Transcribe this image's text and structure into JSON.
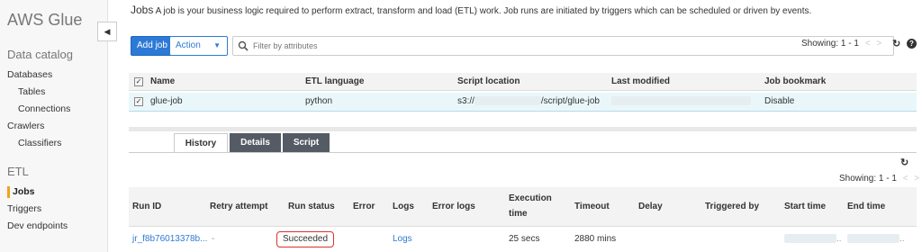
{
  "sidebar": {
    "brand": "AWS Glue",
    "data_catalog": "Data catalog",
    "databases": "Databases",
    "tables": "Tables",
    "connections": "Connections",
    "crawlers": "Crawlers",
    "classifiers": "Classifiers",
    "etl": "ETL",
    "jobs": "Jobs",
    "triggers": "Triggers",
    "dev_endpoints": "Dev endpoints",
    "collapse_icon": "caret-left-icon"
  },
  "header": {
    "title": "Jobs",
    "description": "A job is your business logic required to perform extract, transform and load (ETL) work. Job runs are initiated by triggers which can be scheduled or driven by events."
  },
  "toolbar": {
    "add_job": "Add job",
    "action": "Action",
    "filter_placeholder": "Filter by attributes",
    "showing": "Showing: 1 - 1",
    "prev": "<",
    "next": ">"
  },
  "jobs_table": {
    "columns": [
      "Name",
      "ETL language",
      "Script location",
      "Last modified",
      "Job bookmark"
    ],
    "rows": [
      {
        "name": "glue-job",
        "language": "python",
        "script_prefix": "s3://",
        "script_suffix": "/script/glue-job",
        "bookmark": "Disable"
      }
    ]
  },
  "tabs": [
    "History",
    "Details",
    "Script"
  ],
  "history": {
    "showing": "Showing: 1 - 1",
    "prev": "<",
    "next": ">",
    "columns": {
      "run_id": "Run ID",
      "retry": "Retry attempt",
      "run_status": "Run status",
      "error": "Error",
      "logs": "Logs",
      "error_logs": "Error logs",
      "execution_1": "Execution",
      "execution_2": "time",
      "timeout": "Timeout",
      "delay": "Delay",
      "triggered_by": "Triggered by",
      "start_time": "Start time",
      "end_time": "End time"
    },
    "rows": [
      {
        "run_id": "jr_f8b76013378b...",
        "retry": "-",
        "status": "Succeeded",
        "logs": "Logs",
        "execution": "25 secs",
        "timeout": "2880 mins",
        "start_tail": "..",
        "end_tail": ".."
      }
    ]
  },
  "colors": {
    "accent": "#2d7ad6",
    "status_outline": "#d9322d",
    "active_marker": "#f0a31e"
  }
}
